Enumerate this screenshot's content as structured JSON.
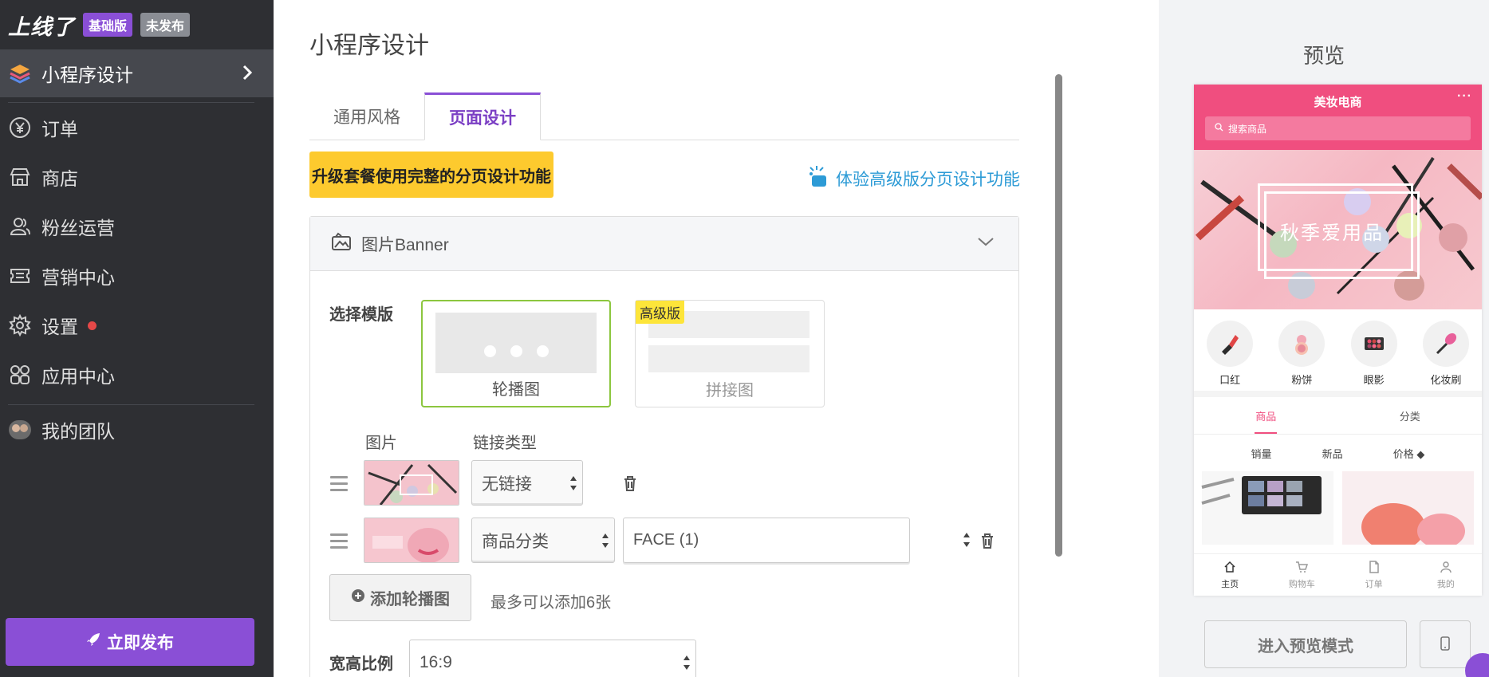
{
  "sidebar": {
    "brand": "上线了",
    "edition_badge": "基础版",
    "status_badge": "未发布",
    "active_item": "小程序设计",
    "items": [
      {
        "label": "订单",
        "icon": "yen-circle-icon"
      },
      {
        "label": "商店",
        "icon": "store-icon"
      },
      {
        "label": "粉丝运营",
        "icon": "fans-icon"
      },
      {
        "label": "营销中心",
        "icon": "ticket-icon"
      },
      {
        "label": "设置",
        "icon": "gear-icon"
      },
      {
        "label": "应用中心",
        "icon": "apps-icon"
      }
    ],
    "team_label": "我的团队",
    "publish_label": "立即发布"
  },
  "main": {
    "title": "小程序设计",
    "tabs": [
      {
        "label": "通用风格",
        "active": false
      },
      {
        "label": "页面设计",
        "active": true
      }
    ],
    "upgrade_label": "升级套餐使用完整的分页设计功能",
    "try_link": "体验高级版分页设计功能",
    "section_title": "图片Banner",
    "template_label": "选择模版",
    "templates": [
      {
        "caption": "轮播图",
        "selected": true
      },
      {
        "caption": "拼接图",
        "selected": false,
        "tag": "高级版"
      }
    ],
    "col_image": "图片",
    "col_link_type": "链接类型",
    "rows": [
      {
        "link_type": "无链接",
        "target": ""
      },
      {
        "link_type": "商品分类",
        "target": "FACE (1)"
      }
    ],
    "add_button": "添加轮播图",
    "add_hint": "最多可以添加6张",
    "ratio_label": "宽高比例",
    "ratio_value": "16:9"
  },
  "preview": {
    "title": "预览",
    "store_name": "美妆电商",
    "more": "···",
    "search_placeholder": "搜索商品",
    "banner_text": "秋季爱用品",
    "categories": [
      "口红",
      "粉饼",
      "眼影",
      "化妆刷"
    ],
    "tabs": [
      "商品",
      "分类"
    ],
    "sort": [
      "销量",
      "新品",
      "价格"
    ],
    "bottom_nav": [
      "主页",
      "购物车",
      "订单",
      "我的"
    ],
    "enter_preview": "进入预览模式"
  }
}
